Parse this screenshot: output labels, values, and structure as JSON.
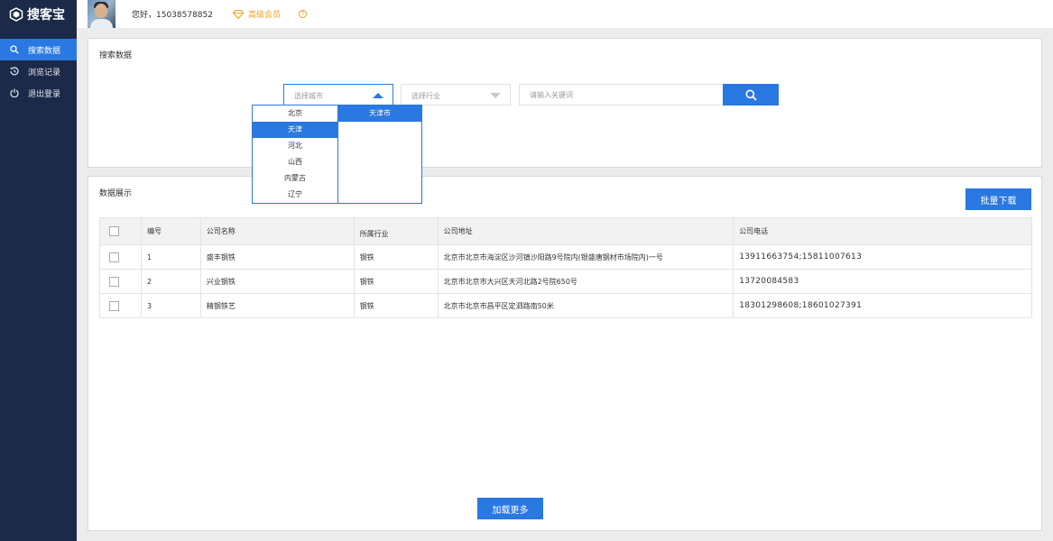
{
  "app": {
    "name": "搜客宝"
  },
  "sidebar": {
    "items": [
      {
        "label": "搜索数据",
        "icon": "search-icon"
      },
      {
        "label": "浏览记录",
        "icon": "history-icon"
      },
      {
        "label": "退出登录",
        "icon": "power-icon"
      }
    ]
  },
  "header": {
    "greeting": "您好，15038578852",
    "vip_label": "高级会员",
    "help_glyph": "?"
  },
  "search": {
    "title": "搜索数据",
    "city_placeholder": "选择城市",
    "industry_placeholder": "选择行业",
    "keyword_placeholder": "请输入关键词"
  },
  "dropdown": {
    "provinces": [
      "北京",
      "天津",
      "河北",
      "山西",
      "内蒙古",
      "辽宁"
    ],
    "selected_province": "天津",
    "cities": [
      "天津市"
    ]
  },
  "data_panel": {
    "title": "数据展示",
    "batch_download": "批量下载",
    "load_more": "加载更多",
    "columns": [
      "编号",
      "公司名称",
      "所属行业",
      "公司地址",
      "公司电话"
    ],
    "rows": [
      {
        "id": "1",
        "name": "盛丰钢铁",
        "industry": "钢铁",
        "address": "北京市北京市海淀区沙河镇沙阳路9号院内(银盛唐钢材市场院内)一号",
        "phone": "13911663754;15811007613"
      },
      {
        "id": "2",
        "name": "兴业钢铁",
        "industry": "钢铁",
        "address": "北京市北京市大兴区天河北路2号院650号",
        "phone": "13720084583"
      },
      {
        "id": "3",
        "name": "精钢铁艺",
        "industry": "钢铁",
        "address": "北京市北京市昌平区定泗路南50米",
        "phone": "18301298608;18601027391"
      }
    ]
  },
  "colors": {
    "accent": "#2a78e2",
    "sidebar_bg": "#1b2a48",
    "vip": "#f0a020"
  }
}
